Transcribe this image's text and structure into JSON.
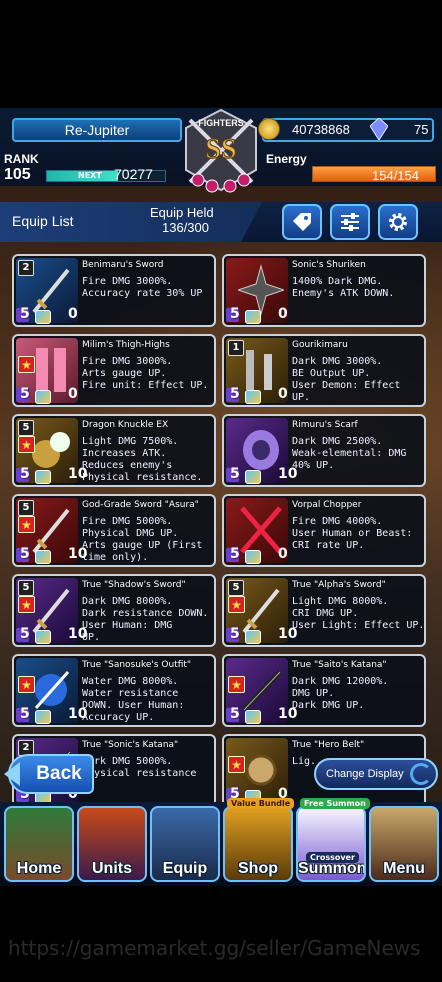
{
  "header": {
    "player_name": "Re-Jupiter",
    "rank_label": "RANK",
    "rank_value": "105",
    "next_label": "NEXT",
    "next_value": "70277",
    "exp_progress": 0.6,
    "emblem_title": "FIGHTERS",
    "emblem_letters": "SS",
    "gold_value": "40738868",
    "gem_value": "75",
    "energy_label": "Energy",
    "energy_value": "154/154",
    "energy_progress": 1.0
  },
  "list_bar": {
    "title": "Equip List",
    "held_label": "Equip Held",
    "held_value": "136/300",
    "buttons": [
      "tag-icon",
      "filter-icon",
      "gear-icon"
    ]
  },
  "cards": [
    {
      "name": "Benimaru's Sword",
      "desc": "Fire DMG 3000%.\nAccuracy rate 30% UP",
      "rank": "2",
      "level": "5",
      "count": "0",
      "theme": "blue",
      "icon": "sword-icon",
      "starred": false
    },
    {
      "name": "Sonic's Shuriken",
      "desc": "1400% Dark DMG.\nEnemy's ATK DOWN.",
      "rank": "",
      "level": "5",
      "count": "0",
      "theme": "red",
      "icon": "shuriken-icon",
      "starred": false
    },
    {
      "name": "Milim's Thigh-Highs",
      "desc": "Fire DMG 3000%.\nArts gauge UP.\nFire unit: Effect UP.",
      "rank": "",
      "level": "5",
      "count": "0",
      "theme": "pink",
      "icon": "stockings-icon",
      "starred": true
    },
    {
      "name": "Gourikimaru",
      "desc": "Dark DMG 3000%.\nBE Output UP.\nUser Demon: Effect\nUP.",
      "rank": "1",
      "level": "5",
      "count": "0",
      "theme": "gold",
      "icon": "dagger-icon",
      "starred": false
    },
    {
      "name": "Dragon Knuckle EX",
      "desc": "Light DMG 7500%.\nIncreases ATK.\nReduces enemy's\nPhysical resistance.",
      "rank": "5",
      "level": "5",
      "count": "10",
      "theme": "gold",
      "icon": "knuckle-icon",
      "starred": true
    },
    {
      "name": "Rimuru's Scarf",
      "desc": "Dark DMG 2500%.\nWeak-elemental: DMG\n40% UP.",
      "rank": "",
      "level": "5",
      "count": "10",
      "theme": "purple",
      "icon": "scarf-icon",
      "starred": false
    },
    {
      "name": "God-Grade Sword \"Asura\"",
      "desc": "Fire DMG 5000%.\nPhysical DMG UP.\nArts gauge UP (First\ntime only).",
      "rank": "5",
      "level": "5",
      "count": "10",
      "theme": "red",
      "icon": "sword-icon",
      "starred": true
    },
    {
      "name": "Vorpal Chopper",
      "desc": "Fire DMG 4000%.\nUser Human or Beast:\nCRI rate UP.",
      "rank": "",
      "level": "5",
      "count": "0",
      "theme": "red",
      "icon": "crossed-blades-icon",
      "starred": false
    },
    {
      "name": "True \"Shadow's Sword\"",
      "desc": "Dark DMG 8000%.\nDark resistance DOWN.\nUser Human: DMG\nUP.",
      "rank": "5",
      "level": "5",
      "count": "10",
      "theme": "purple",
      "icon": "sword-icon",
      "starred": true
    },
    {
      "name": "True \"Alpha's Sword\"",
      "desc": "Light DMG 8000%.\nCRI DMG UP.\nUser Light: Effect UP.",
      "rank": "5",
      "level": "5",
      "count": "10",
      "theme": "gold",
      "icon": "sword-icon",
      "starred": true
    },
    {
      "name": "True \"Sanosuke's Outfit\"",
      "desc": "Water DMG 8000%.\nWater resistance\nDOWN. User Human:\nAccuracy UP.",
      "rank": "",
      "level": "5",
      "count": "10",
      "theme": "blue",
      "icon": "outfit-icon",
      "starred": true
    },
    {
      "name": "True \"Saito's Katana\"",
      "desc": "Dark DMG 12000%.\nDMG UP.\nDark DMG UP.",
      "rank": "",
      "level": "5",
      "count": "10",
      "theme": "purple",
      "icon": "katana-icon",
      "starred": true
    },
    {
      "name": "True \"Sonic's Katana\"",
      "desc": "Dark DMG 5000%.\nPhysical resistance",
      "rank": "2",
      "level": "5",
      "count": "0",
      "theme": "purple",
      "icon": "katana-icon",
      "starred": false
    },
    {
      "name": "True \"Hero Belt\"",
      "desc": "Lig...",
      "rank": "",
      "level": "5",
      "count": "0",
      "theme": "gold",
      "icon": "belt-icon",
      "starred": true
    }
  ],
  "back_label": "Back",
  "change_display_label": "Change Display",
  "nav": [
    {
      "label": "Home",
      "icon": "house-icon",
      "tag": ""
    },
    {
      "label": "Units",
      "icon": "hero-icon",
      "tag": ""
    },
    {
      "label": "Equip",
      "icon": "sword-icon",
      "tag": ""
    },
    {
      "label": "Shop",
      "icon": "treasure-icon",
      "tag": "Value Bundle"
    },
    {
      "label": "Summon",
      "icon": "summon-icon",
      "tag": "Free Summon",
      "subtag": "Crossover"
    },
    {
      "label": "Menu",
      "icon": "book-icon",
      "tag": ""
    }
  ],
  "watermark": "https://gamemarket.gg/seller/GameNews"
}
